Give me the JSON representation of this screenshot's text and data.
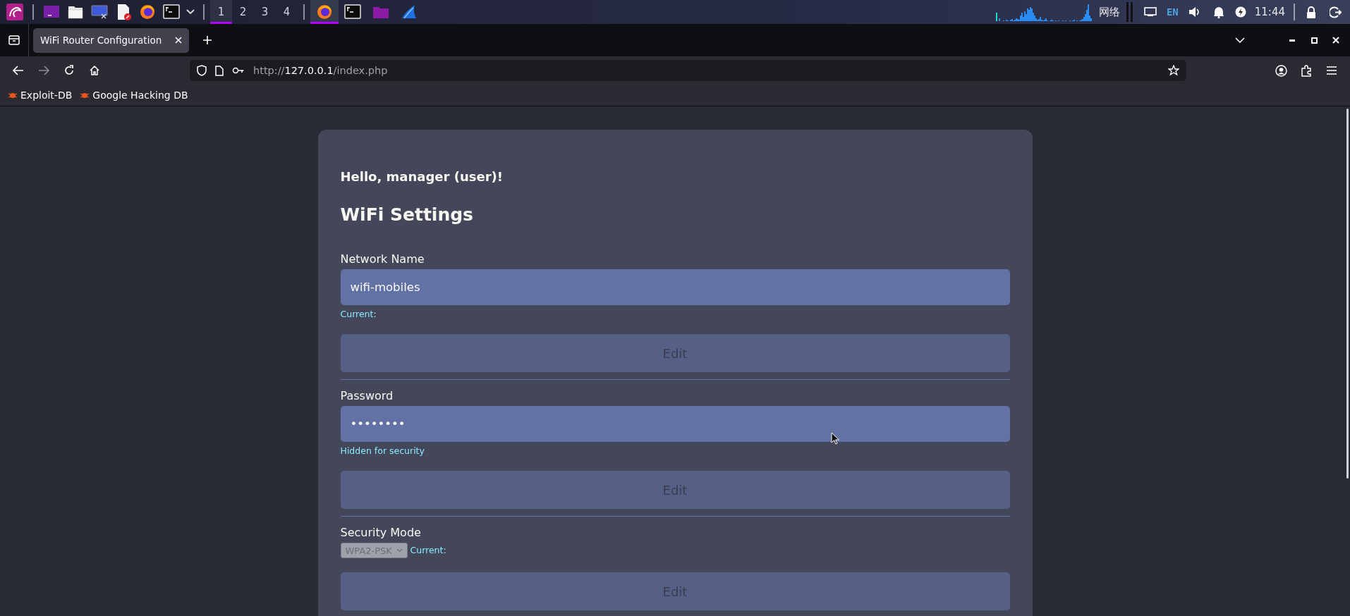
{
  "taskbar": {
    "workspaces": [
      {
        "label": "1",
        "selected": true
      },
      {
        "label": "2",
        "selected": false
      },
      {
        "label": "3",
        "selected": false
      },
      {
        "label": "4",
        "selected": false
      }
    ],
    "task_buttons": [
      {
        "selected": true
      },
      {
        "selected": false
      },
      {
        "selected": false
      },
      {
        "selected": false
      }
    ],
    "network_label": "网络",
    "keyboard_layout": "EN",
    "clock": "11:44"
  },
  "browser": {
    "tabs": [
      {
        "title": "WiFi Router Configuration",
        "selected": true
      }
    ],
    "url": {
      "scheme": "http://",
      "host": "127.0.0.1",
      "path": "/index.php"
    },
    "bookmarks": [
      "Exploit-DB",
      "Google Hacking DB"
    ]
  },
  "page": {
    "greeting": "Hello, manager (user)!",
    "heading": "WiFi Settings",
    "sections": [
      {
        "kind": "text",
        "label": "Network Name",
        "value": "wifi-mobiles",
        "hint": "Current:",
        "button": {
          "label": "Edit",
          "disabled": true
        }
      },
      {
        "kind": "text",
        "label": "Password",
        "value": "••••••••",
        "hint": "Hidden for security",
        "button": {
          "label": "Edit",
          "disabled": true
        }
      },
      {
        "kind": "select",
        "label": "Security Mode",
        "value": "WPA2-PSK",
        "disabled": true,
        "hint": "Current:",
        "button": {
          "label": "Edit",
          "disabled": true
        }
      }
    ]
  }
}
